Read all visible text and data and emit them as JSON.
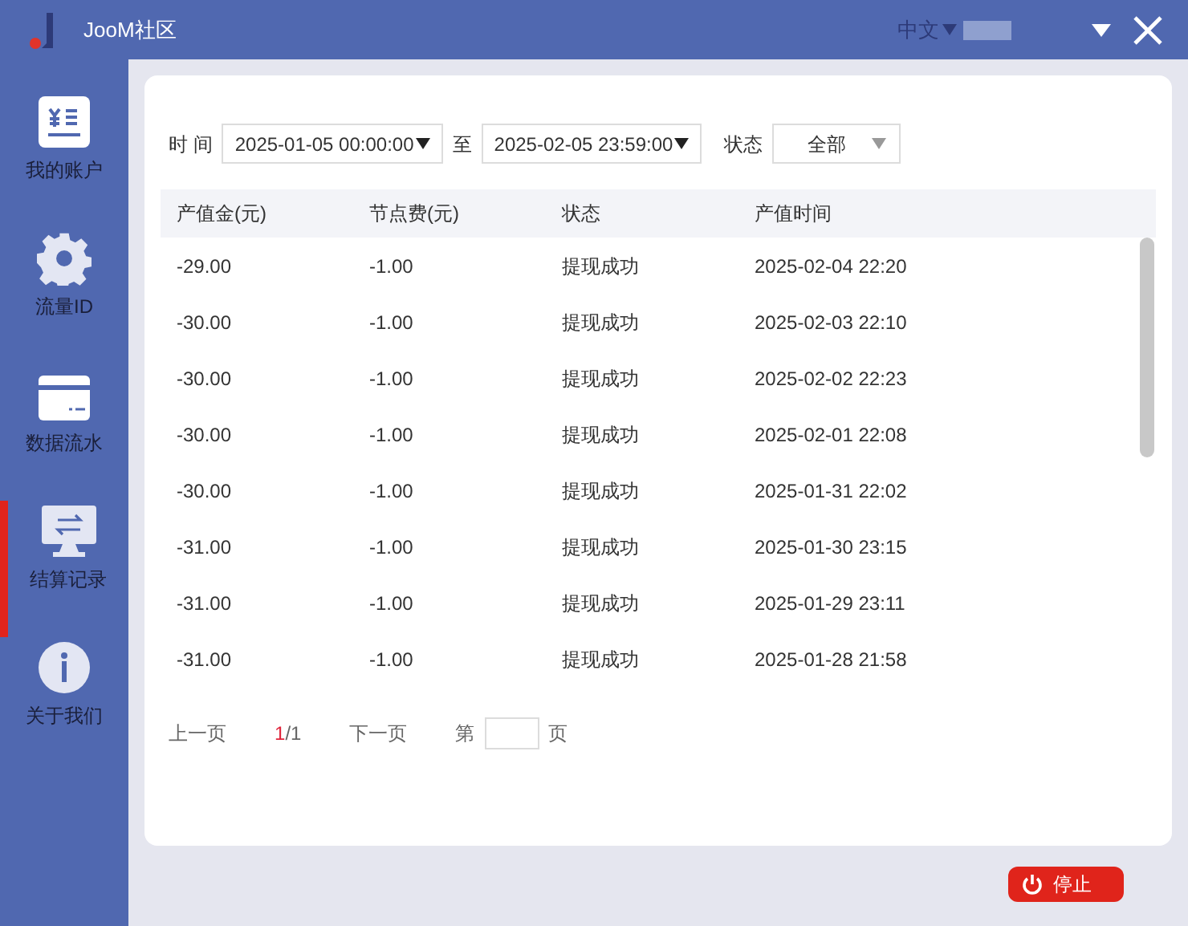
{
  "window": {
    "title": "JooM社区",
    "language": "中文"
  },
  "sidebar": {
    "items": [
      {
        "label": "我的账户",
        "kind": "account",
        "selected": false
      },
      {
        "label": "流量ID",
        "kind": "gear",
        "selected": false
      },
      {
        "label": "数据流水",
        "kind": "card",
        "selected": false
      },
      {
        "label": "结算记录",
        "kind": "monitor",
        "selected": true
      },
      {
        "label": "关于我们",
        "kind": "info",
        "selected": false
      }
    ]
  },
  "filters": {
    "time_label": "时 间",
    "start": "2025-01-05 00:00:00",
    "to_label": "至",
    "end": "2025-02-05 23:59:00",
    "status_label": "状态",
    "status": "全部"
  },
  "table": {
    "columns": [
      "产值金(元)",
      "节点费(元)",
      "状态",
      "产值时间"
    ],
    "rows": [
      [
        "-29.00",
        "-1.00",
        "提现成功",
        "2025-02-04 22:20"
      ],
      [
        "-30.00",
        "-1.00",
        "提现成功",
        "2025-02-03 22:10"
      ],
      [
        "-30.00",
        "-1.00",
        "提现成功",
        "2025-02-02 22:23"
      ],
      [
        "-30.00",
        "-1.00",
        "提现成功",
        "2025-02-01 22:08"
      ],
      [
        "-30.00",
        "-1.00",
        "提现成功",
        "2025-01-31 22:02"
      ],
      [
        "-31.00",
        "-1.00",
        "提现成功",
        "2025-01-30 23:15"
      ],
      [
        "-31.00",
        "-1.00",
        "提现成功",
        "2025-01-29 23:11"
      ],
      [
        "-31.00",
        "-1.00",
        "提现成功",
        "2025-01-28 21:58"
      ]
    ]
  },
  "pagination": {
    "prev": "上一页",
    "current": "1",
    "total": "/1",
    "next": "下一页",
    "page_prefix": "第",
    "page_suffix": "页"
  },
  "stop_button": "停止"
}
